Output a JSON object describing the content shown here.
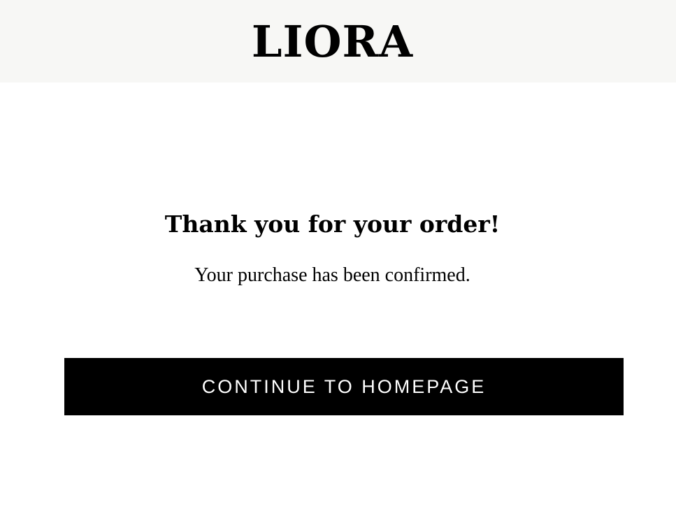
{
  "header": {
    "brand": "LIORA"
  },
  "confirmation": {
    "title": "Thank you for your order!",
    "message": "Your purchase has been confirmed.",
    "cta_label": "CONTINUE TO HOMEPAGE"
  },
  "colors": {
    "header_background": "#f7f7f5",
    "page_background": "#ffffff",
    "button_background": "#000000",
    "button_text": "#ffffff",
    "text": "#000000"
  }
}
